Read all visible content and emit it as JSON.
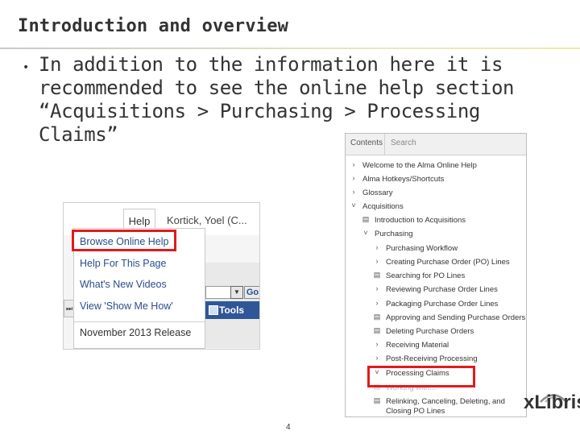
{
  "slide": {
    "title": "Introduction and overview",
    "bullet_marker": "•",
    "bullet_text": "In addition to the information here it is recommended to see the online help section “Acquisitions > Purchasing > Processing Claims”",
    "page_number": "4",
    "logo_text": "xLibris"
  },
  "help_screenshot": {
    "tab_label": "Help",
    "user_name": "Kortick, Yoel (C...",
    "menu_items": [
      "Browse Online Help",
      "Help For This Page",
      "What's New Videos",
      "View 'Show Me How'"
    ],
    "release_label": "November 2013 Release",
    "go_label": "Go",
    "tools_label": "Tools",
    "left_arrow": "⏭",
    "dropdown_arrow": "▼",
    "highlight_color": "#e3191b"
  },
  "contents_screenshot": {
    "tab_contents": "Contents",
    "tab_search": "Search",
    "tree": [
      {
        "icon": "›",
        "label": "Welcome to the Alma Online Help"
      },
      {
        "icon": "›",
        "label": "Alma Hotkeys/Shortcuts"
      },
      {
        "icon": "›",
        "label": "Glossary"
      },
      {
        "icon": "˅",
        "label": "Acquisitions"
      },
      {
        "icon": "▤",
        "label": "Introduction to Acquisitions"
      },
      {
        "icon": "˅",
        "label": "Purchasing"
      },
      {
        "icon": "›",
        "label": "Purchasing Workflow"
      },
      {
        "icon": "›",
        "label": "Creating Purchase Order (PO) Lines"
      },
      {
        "icon": "▤",
        "label": "Searching for PO Lines"
      },
      {
        "icon": "›",
        "label": "Reviewing Purchase Order Lines"
      },
      {
        "icon": "›",
        "label": "Packaging Purchase Order Lines"
      },
      {
        "icon": "▤",
        "label": "Approving and Sending Purchase Orders"
      },
      {
        "icon": "▤",
        "label": "Deleting Purchase Orders"
      },
      {
        "icon": "›",
        "label": "Receiving Material"
      },
      {
        "icon": "›",
        "label": "Post-Receiving Processing"
      },
      {
        "icon": "˅",
        "label": "Processing Claims"
      },
      {
        "icon": "▤",
        "label": "Working with..."
      },
      {
        "icon": "▤",
        "label": "Relinking, Canceling, Deleting, and"
      },
      {
        "icon": "",
        "label": "Closing PO Lines"
      }
    ]
  }
}
